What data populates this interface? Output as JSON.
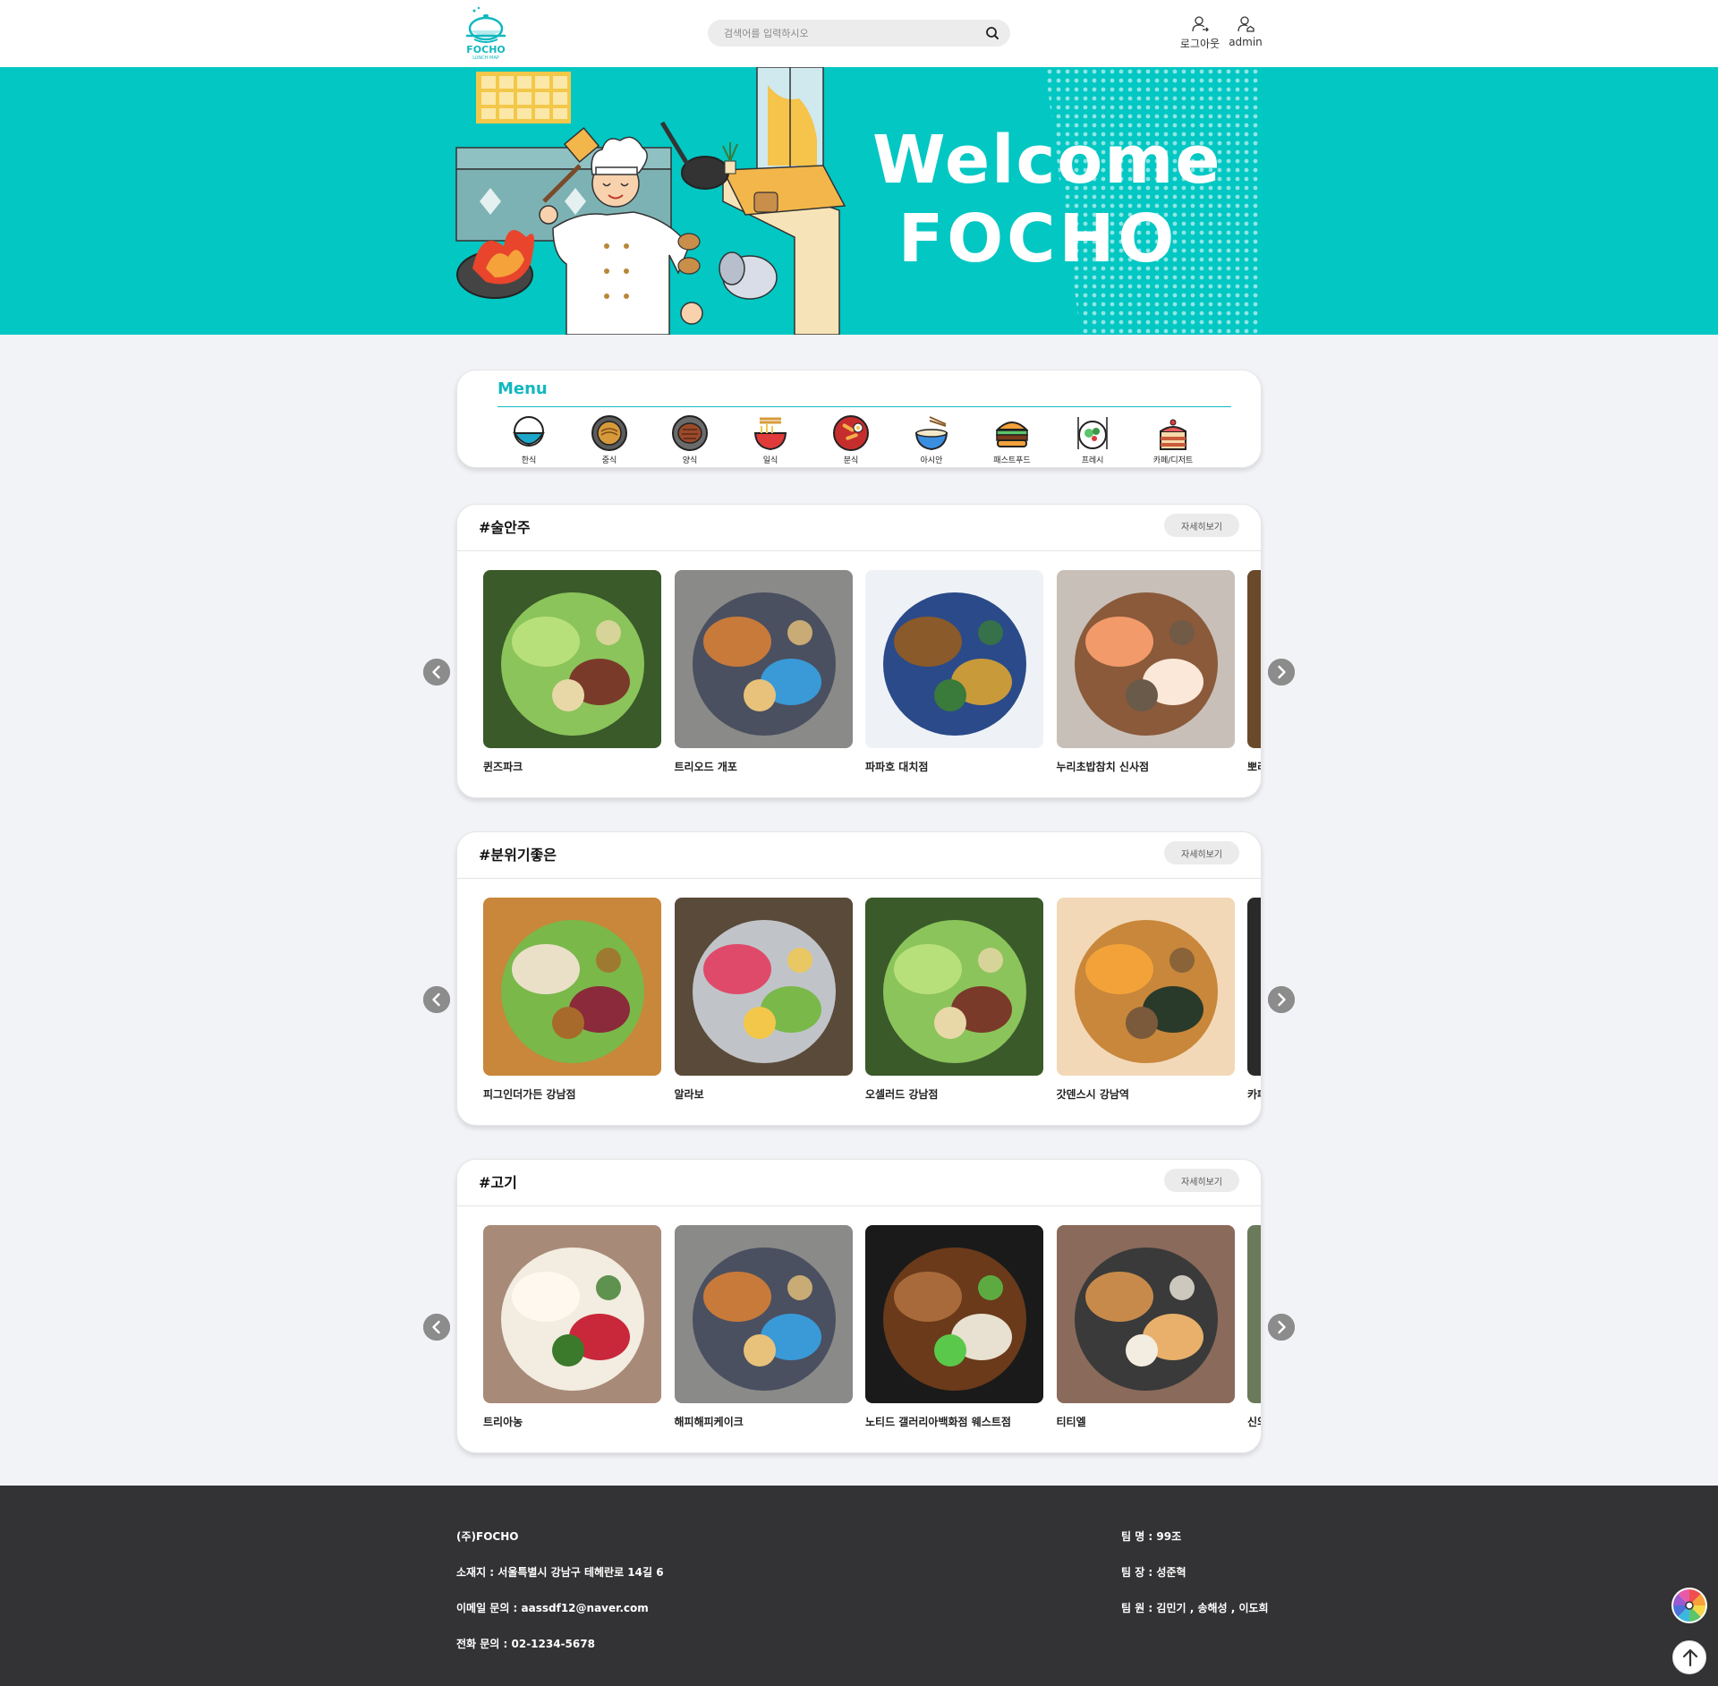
{
  "header": {
    "logo_text": "FOCHO",
    "logo_sub": "LUNCH MAP",
    "search_placeholder": "검색어를 입력하시오",
    "logout_label": "로그아웃",
    "user_label": "admin"
  },
  "banner": {
    "line1": "Welcome",
    "line2": "FOCHO"
  },
  "menu": {
    "title": "Menu",
    "items": [
      {
        "label": "한식",
        "icon": "rice-bowl-icon"
      },
      {
        "label": "중식",
        "icon": "noodle-plate-icon"
      },
      {
        "label": "양식",
        "icon": "steak-plate-icon"
      },
      {
        "label": "일식",
        "icon": "ramen-bowl-icon"
      },
      {
        "label": "분식",
        "icon": "tteokbokki-plate-icon"
      },
      {
        "label": "아시안",
        "icon": "pho-bowl-icon"
      },
      {
        "label": "패스트푸드",
        "icon": "burger-icon"
      },
      {
        "label": "프레시",
        "icon": "salad-icon"
      },
      {
        "label": "카페/디저트",
        "icon": "cake-icon"
      }
    ]
  },
  "sections": [
    {
      "title": "#술안주",
      "more_label": "자세히보기",
      "items": [
        "퀸즈파크",
        "트리오드 개포",
        "파파호 대치점",
        "누리초밥참치 신사점",
        "뽀리"
      ]
    },
    {
      "title": "#분위기좋은",
      "more_label": "자세히보기",
      "items": [
        "피그인더가든 강남점",
        "알라보",
        "오셀러드 강남점",
        "갓덴스시 강남역",
        "카페"
      ]
    },
    {
      "title": "#고기",
      "more_label": "자세히보기",
      "items": [
        "트리아농",
        "해피해피케이크",
        "노티드 갤러리아백화점 웨스트점",
        "티티엘",
        "신의"
      ]
    }
  ],
  "footer": {
    "company": "(주)FOCHO",
    "address": "소재지 : 서울특별시 강남구 테헤란로 14길 6",
    "email": "이메일 문의 : aassdf12@naver.com",
    "phone": "전화 문의 : 02-1234-5678",
    "team_name": "팀 명 : 99조",
    "team_leader": "팀 장 : 성준혁",
    "team_members": "팀 원 : 김민기 , 송해성 , 이도희"
  },
  "colors": {
    "accent": "#12b8c0",
    "banner": "#02c7c3",
    "footer": "#333335",
    "page_bg": "#f2f3f7"
  }
}
